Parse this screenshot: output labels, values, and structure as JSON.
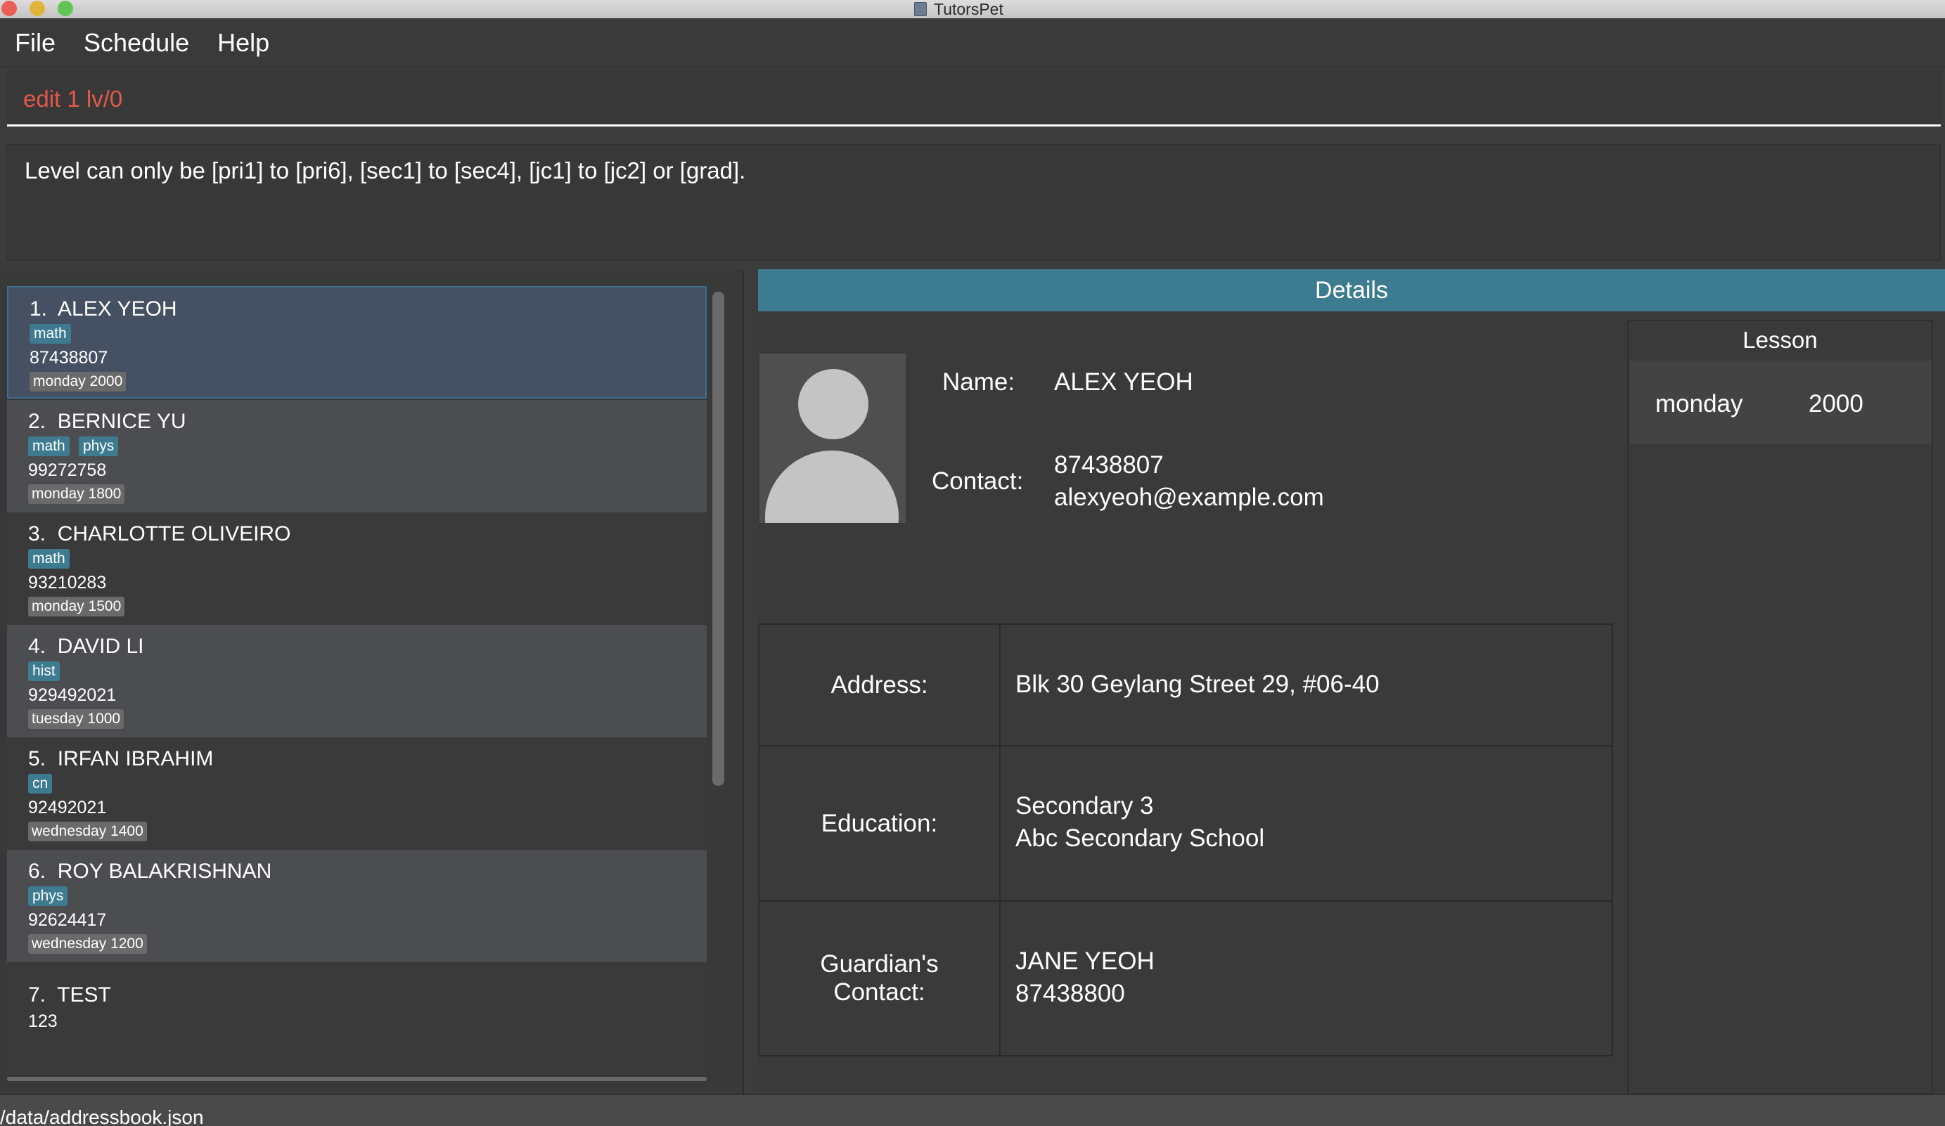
{
  "window": {
    "title": "TutorsPet"
  },
  "menu": {
    "items": [
      "File",
      "Schedule",
      "Help"
    ]
  },
  "command": {
    "value": "edit 1 lv/0"
  },
  "result": {
    "message": "Level can only be [pri1] to [pri6], [sec1] to [sec4], [jc1] to [jc2] or [grad]."
  },
  "persons": [
    {
      "index": "1.",
      "name": "ALEX YEOH",
      "tags": [
        "math"
      ],
      "phone": "87438807",
      "lesson": "monday 2000",
      "selected": true
    },
    {
      "index": "2.",
      "name": "BERNICE YU",
      "tags": [
        "math",
        "phys"
      ],
      "phone": "99272758",
      "lesson": "monday 1800"
    },
    {
      "index": "3.",
      "name": "CHARLOTTE OLIVEIRO",
      "tags": [
        "math"
      ],
      "phone": "93210283",
      "lesson": "monday 1500"
    },
    {
      "index": "4.",
      "name": "DAVID LI",
      "tags": [
        "hist"
      ],
      "phone": "929492021",
      "lesson": "tuesday 1000"
    },
    {
      "index": "5.",
      "name": "IRFAN IBRAHIM",
      "tags": [
        "cn"
      ],
      "phone": "92492021",
      "lesson": "wednesday 1400"
    },
    {
      "index": "6.",
      "name": "ROY BALAKRISHNAN",
      "tags": [
        "phys"
      ],
      "phone": "92624417",
      "lesson": "wednesday 1200"
    },
    {
      "index": "7.",
      "name": "TEST",
      "tags": [],
      "phone": "123",
      "lesson": ""
    }
  ],
  "details": {
    "header": "Details",
    "name_label": "Name:",
    "name": "ALEX YEOH",
    "contact_label": "Contact:",
    "phone": "87438807",
    "email": "alexyeoh@example.com",
    "address_label": "Address:",
    "address": "Blk 30 Geylang Street 29, #06-40",
    "education_label": "Education:",
    "education_level": "Secondary 3",
    "school": "Abc Secondary School",
    "guardian_label_1": "Guardian's",
    "guardian_label_2": "Contact:",
    "guardian_name": "JANE YEOH",
    "guardian_phone": "87438800"
  },
  "lesson_panel": {
    "title": "Lesson",
    "lessons": [
      {
        "day": "monday",
        "time": "2000"
      }
    ]
  },
  "status": {
    "path": "/data/addressbook.json"
  }
}
